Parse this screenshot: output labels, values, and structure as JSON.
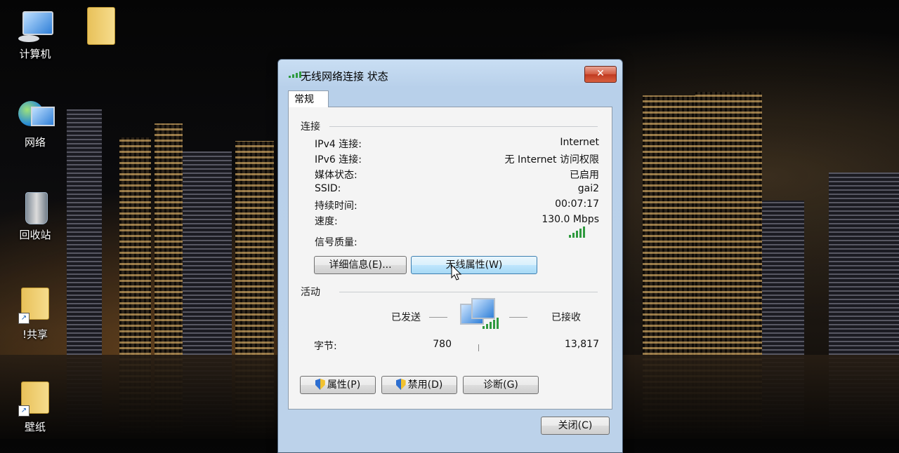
{
  "desktop": {
    "icons": [
      {
        "label": "计算机"
      },
      {
        "label": ""
      },
      {
        "label": "网络"
      },
      {
        "label": "回收站"
      },
      {
        "label": "!共享"
      },
      {
        "label": "壁纸"
      }
    ]
  },
  "dialog": {
    "title": "无线网络连接 状态",
    "close_label": "✕",
    "tab": "常规",
    "connection": {
      "heading": "连接",
      "rows": [
        {
          "label": "IPv4 连接:",
          "value": "Internet"
        },
        {
          "label": "IPv6 连接:",
          "value": "无 Internet 访问权限"
        },
        {
          "label": "媒体状态:",
          "value": "已启用"
        },
        {
          "label": "SSID:",
          "value": "gai2"
        },
        {
          "label": "持续时间:",
          "value": "00:07:17"
        },
        {
          "label": "速度:",
          "value": "130.0 Mbps"
        },
        {
          "label": "信号质量:",
          "value": ""
        }
      ],
      "signal_bars": 5,
      "details_button": "详细信息(E)...",
      "wireless_props_button": "无线属性(W)"
    },
    "activity": {
      "heading": "活动",
      "sent_label": "已发送",
      "received_label": "已接收",
      "bytes_label": "字节:",
      "bytes_sent": "780",
      "bytes_received": "13,817"
    },
    "buttons": {
      "properties": "属性(P)",
      "disable": "禁用(D)",
      "diagnose": "诊断(G)",
      "close": "关闭(C)"
    }
  },
  "colors": {
    "dialog_frame": "#bcd2ea",
    "close_button": "#c03a20",
    "signal_green": "#2f9a3f",
    "hover_button": "#bee6fd"
  }
}
